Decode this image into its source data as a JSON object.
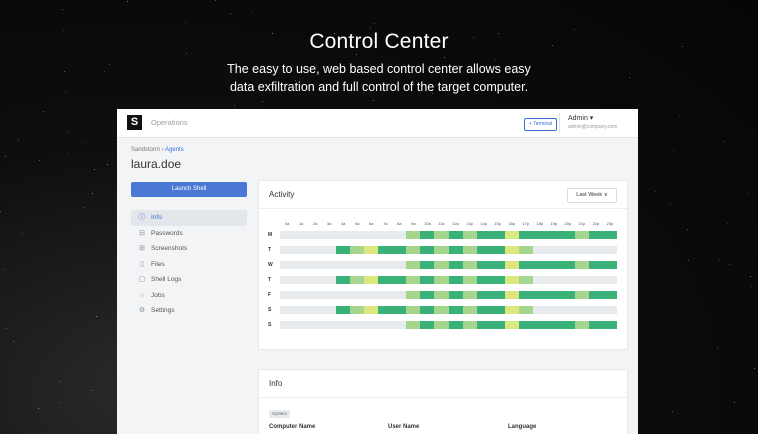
{
  "hero": {
    "title": "Control Center",
    "subtitle_line1": "The easy to use, web based control center allows easy",
    "subtitle_line2": "data exfiltration and full control of the target computer."
  },
  "app": {
    "logo": "S",
    "name": "Operations",
    "terminal_label": "+ Terminal",
    "user": {
      "name": "Admin ▾",
      "email": "admin@company.com"
    }
  },
  "breadcrumb": {
    "parent": "Sandstorm",
    "sep": " › ",
    "current": "Agents"
  },
  "agent_name": "laura.doe",
  "launch_shell_label": "Launch Shell",
  "sidebar": {
    "items": [
      {
        "label": "Info",
        "icon": "info-icon",
        "glyph": "ⓘ",
        "active": true
      },
      {
        "label": "Passwords",
        "icon": "key-icon",
        "glyph": "⊟",
        "active": false
      },
      {
        "label": "Screenshots",
        "icon": "screenshot-icon",
        "glyph": "⊞",
        "active": false
      },
      {
        "label": "Files",
        "icon": "file-icon",
        "glyph": "▯",
        "active": false
      },
      {
        "label": "Shell Logs",
        "icon": "chat-icon",
        "glyph": "▢",
        "active": false
      },
      {
        "label": "Jobs",
        "icon": "clock-icon",
        "glyph": "○",
        "active": false
      },
      {
        "label": "Settings",
        "icon": "gear-icon",
        "glyph": "⚙",
        "active": false
      }
    ]
  },
  "activity": {
    "title": "Activity",
    "range_label": "Last Week ∨",
    "hours": [
      "0a",
      "1a",
      "2a",
      "3a",
      "4a",
      "5a",
      "6a",
      "7a",
      "8a",
      "9a",
      "10a",
      "11a",
      "12p",
      "13p",
      "14p",
      "15p",
      "16p",
      "17p",
      "18p",
      "19p",
      "20p",
      "21p",
      "22p",
      "23p"
    ],
    "days": [
      {
        "label": "M",
        "cells": [
          0,
          0,
          0,
          0,
          0,
          0,
          0,
          0,
          0,
          1,
          2,
          1,
          2,
          1,
          2,
          2,
          3,
          2,
          2,
          2,
          2,
          1,
          2,
          2
        ]
      },
      {
        "label": "T",
        "cells": [
          0,
          0,
          0,
          0,
          2,
          1,
          3,
          2,
          2,
          1,
          2,
          1,
          2,
          1,
          2,
          2,
          3,
          1,
          0,
          0,
          0,
          0,
          0,
          0
        ]
      },
      {
        "label": "W",
        "cells": [
          0,
          0,
          0,
          0,
          0,
          0,
          0,
          0,
          0,
          1,
          2,
          1,
          2,
          1,
          2,
          2,
          3,
          2,
          2,
          2,
          2,
          1,
          2,
          2
        ]
      },
      {
        "label": "T",
        "cells": [
          0,
          0,
          0,
          0,
          2,
          1,
          3,
          2,
          2,
          1,
          2,
          1,
          2,
          1,
          2,
          2,
          3,
          1,
          0,
          0,
          0,
          0,
          0,
          0
        ]
      },
      {
        "label": "F",
        "cells": [
          0,
          0,
          0,
          0,
          0,
          0,
          0,
          0,
          0,
          1,
          2,
          1,
          2,
          1,
          2,
          2,
          3,
          2,
          2,
          2,
          2,
          1,
          2,
          2
        ]
      },
      {
        "label": "S",
        "cells": [
          0,
          0,
          0,
          0,
          2,
          1,
          3,
          2,
          2,
          1,
          2,
          1,
          2,
          1,
          2,
          2,
          3,
          1,
          0,
          0,
          0,
          0,
          0,
          0
        ]
      },
      {
        "label": "S",
        "cells": [
          0,
          0,
          0,
          0,
          0,
          0,
          0,
          0,
          0,
          1,
          2,
          1,
          2,
          1,
          2,
          2,
          3,
          2,
          2,
          2,
          2,
          1,
          2,
          2
        ]
      }
    ],
    "level_colors": {
      "0": "#e8ebee",
      "1": "#a6d58e",
      "2": "#3bb17a",
      "3": "#dde77f"
    }
  },
  "info": {
    "title": "Info",
    "tag": "System",
    "columns": [
      "Computer Name",
      "User Name",
      "Language"
    ]
  }
}
